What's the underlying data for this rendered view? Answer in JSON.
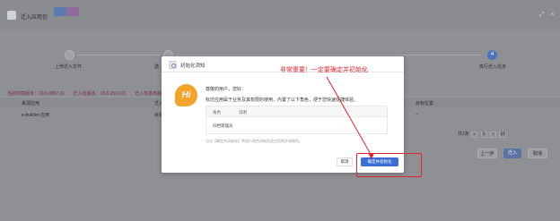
{
  "window": {
    "title": "迁入应用包"
  },
  "steps": [
    {
      "number": "1",
      "label": "上传迁入文件"
    },
    {
      "number": "2",
      "label": "选"
    },
    {
      "number": "3",
      "label": ""
    },
    {
      "number": "4",
      "label": "执行迁入任务"
    }
  ],
  "versions": {
    "current": "当前环境版本：10.6.0867.01",
    "imported": "迁入包版本：10.6.2510.01",
    "third": "迁入包发布版本"
  },
  "table": {
    "headers": [
      "来源应用",
      "迁入",
      "目标位置"
    ],
    "rows": [
      {
        "name": "e-builder-应用",
        "status": "目标",
        "target": "--"
      }
    ]
  },
  "pager": {
    "total": "共1条",
    "current_page": "1",
    "page_size": "10"
  },
  "bottom_buttons": {
    "prev": "上一步",
    "import": "迁入",
    "cancel": "取消"
  },
  "modal": {
    "title": "初始化须知",
    "annotation": "非常重要！一定要确定并初始化",
    "badge": "Hi",
    "greeting": "尊敬的用户，您好：",
    "description": "标迁应用属于业务及其权限的使用，内置了以下角色，便于您快速便捷体验。",
    "role_table": {
      "col_role": "角色",
      "col_desc": "说明",
      "rows": [
        {
          "role": "归档管理员",
          "desc": ""
        }
      ]
    },
    "note": "点击【确定并初始化】将进行角色初始化及应用到开始使用。",
    "cancel": "取消",
    "confirm": "确定并初始化"
  },
  "colors": {
    "accent": "#3c6fd6",
    "annotation": "#e0262f",
    "badge": "#f3a52b"
  }
}
